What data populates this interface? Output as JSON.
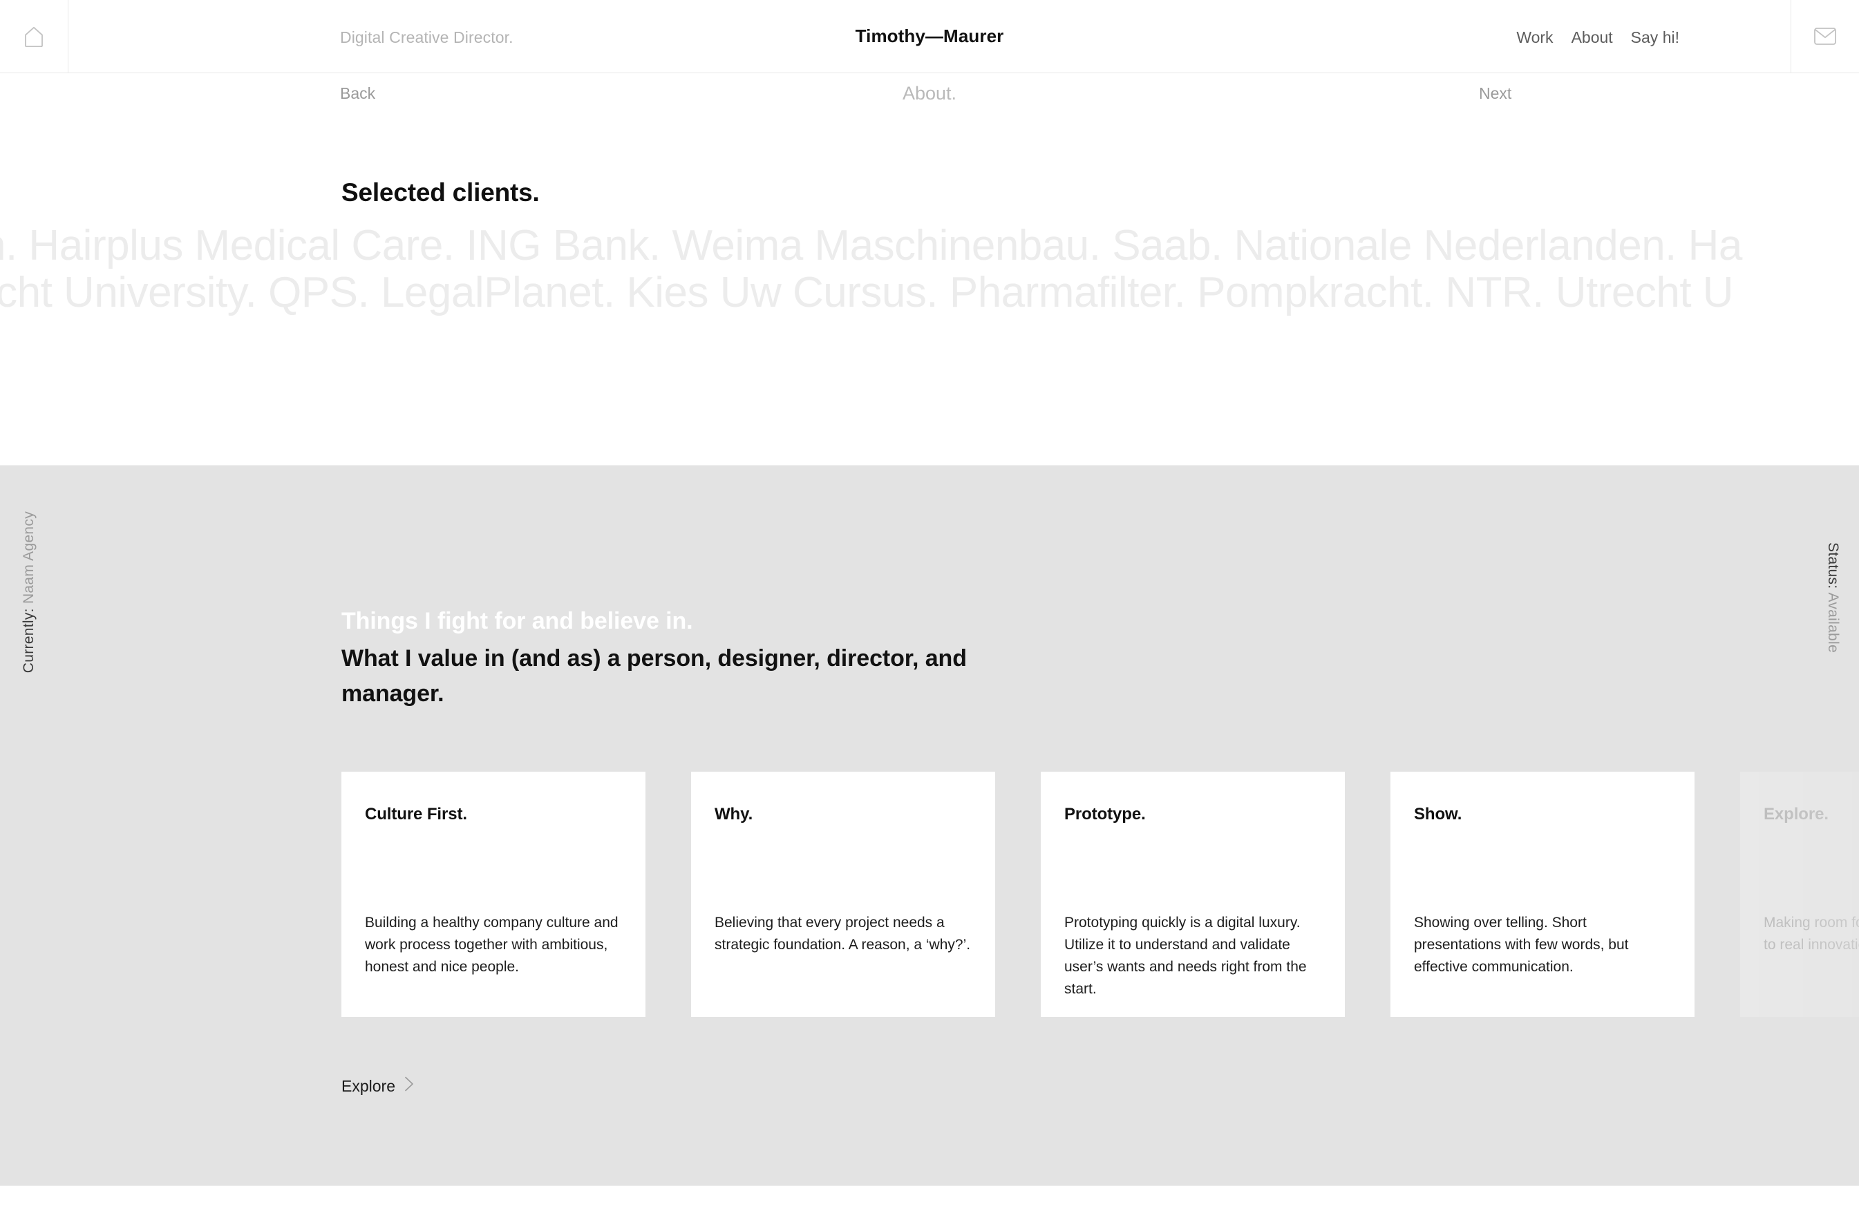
{
  "header": {
    "home_icon": "home-icon",
    "mail_icon": "mail-icon",
    "tagline": "Digital Creative Director.",
    "brand": "Timothy—Maurer",
    "nav": [
      {
        "label": "Work"
      },
      {
        "label": "About"
      },
      {
        "label": "Say hi!"
      }
    ]
  },
  "subnav": {
    "back": "Back",
    "current": "About.",
    "next": "Next"
  },
  "clients": {
    "heading": "Selected clients.",
    "marquee_line_1": "en.  Hairplus Medical Care.  ING Bank.  Weima Maschinenbau.  Saab.  Nationale Nederlanden.  Ha",
    "marquee_line_2": "recht University.  QPS.  LegalPlanet.  Kies Uw Cursus.  Pharmafilter.  Pompkracht.  NTR.  Utrecht U",
    "names": [
      "Hairplus Medical Care.",
      "ING Bank.",
      "Weima Maschinenbau.",
      "Saab.",
      "Nationale Nederlanden.",
      "Utrecht University.",
      "QPS.",
      "LegalPlanet.",
      "Kies Uw Cursus.",
      "Pharmafilter.",
      "Pompkracht.",
      "NTR."
    ]
  },
  "side": {
    "currently_label": "Currently:",
    "currently_value": " Naam Agency",
    "status_label": "Status:",
    "status_value": " Available"
  },
  "values": {
    "kicker": "Things I fight for and believe in.",
    "title": "What I value in (and as) a person, designer, director, and manager.",
    "cards": [
      {
        "title": "Culture First.",
        "body": "Building a healthy company culture and work process together with ambitious, honest and nice people."
      },
      {
        "title": "Why.",
        "body": "Believing that every project needs a strategic foundation. A reason, a ‘why?’."
      },
      {
        "title": "Prototype.",
        "body": "Prototyping quickly is a digital luxury. Utilize it to understand and validate user’s wants and needs right from the start."
      },
      {
        "title": "Show.",
        "body": "Showing over telling. Short presentations with few words, but effective communication."
      },
      {
        "title": "Explore.",
        "body": "Making room for explorations connected to real innovation."
      }
    ],
    "explore_label": "Explore",
    "explore_icon": "chevron-right-icon"
  },
  "colors": {
    "page_background": "#ffffff",
    "section_background": "#e3e3e3",
    "card_background": "#ffffff",
    "text_primary": "#111111",
    "text_muted": "#9a9a9a",
    "marquee_text": "#ececec"
  }
}
